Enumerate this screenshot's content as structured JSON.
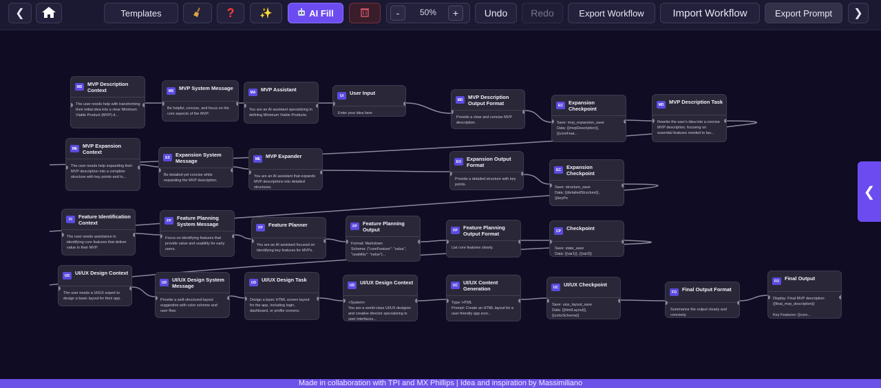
{
  "toolbar": {
    "back_icon": "chevron-left-icon",
    "home_icon": "home-icon",
    "templates_label": "Templates",
    "broom_icon": "broom-icon",
    "help_icon": "question-mark-icon",
    "sparkle_icon": "sparkles-icon",
    "ai_fill_label": "AI Fill",
    "trash_icon": "trash-icon",
    "zoom_out_label": "-",
    "zoom_value": "50%",
    "zoom_in_label": "+",
    "undo_label": "Undo",
    "redo_label": "Redo",
    "export_workflow_label": "Export Workflow",
    "import_workflow_label": "Import Workflow",
    "export_prompt_label": "Export Prompt",
    "forward_icon": "chevron-right-icon"
  },
  "colors": {
    "accent": "#6c4cf0",
    "canvas": "#0f0c24",
    "node": "#2a2838"
  },
  "nodes": [
    {
      "badge": "MD",
      "title": "MVP Description Context",
      "body": "The user needs help with transforming their initial idea into a clear Minimum Viable Product (MVP) d..."
    },
    {
      "badge": "MS",
      "title": "MVP System Message",
      "body": "Be helpful, concise, and focus on the core aspects of the MVP."
    },
    {
      "badge": "MA",
      "title": "MVP Assistant",
      "body": "You are an AI assistant specializing in defining Minimum Viable Products."
    },
    {
      "badge": "UI",
      "title": "User Input",
      "body": "Enter your idea here"
    },
    {
      "badge": "MD",
      "title": "MVP Description Output Format",
      "body": "Provide a clear and concise MVP description."
    },
    {
      "badge": "EC",
      "title": "Expansion Checkpoint",
      "body": "Save: mvp_expansion_save\nData: {{mvpDescription}},\n{{coreFeat..."
    },
    {
      "badge": "MD",
      "title": "MVP Description Task",
      "body": "Rewrite the user's idea into a concise MVP description, focusing on essential features needed to lau..."
    },
    {
      "badge": "ME",
      "title": "MVP Expansion Context",
      "body": "The user needs help expanding their MVP description into a complete structure with key points and lo..."
    },
    {
      "badge": "ES",
      "title": "Expansion System Message",
      "body": "Be detailed yet concise while expanding the MVP description."
    },
    {
      "badge": "ME",
      "title": "MVP Expander",
      "body": "You are an AI assistant that expands MVP descriptions into detailed structures."
    },
    {
      "badge": "EO",
      "title": "Expansion Output Format",
      "body": "Provide a detailed structure with key points."
    },
    {
      "badge": "EC",
      "title": "Expansion Checkpoint",
      "body": "Save: structure_save\nData: {{detailedStructure}},\n{{keyPo"
    },
    {
      "badge": "FI",
      "title": "Feature Identification Context",
      "body": "The user needs assistance in identifying core features that deliver value in their MVP."
    },
    {
      "badge": "FP",
      "title": "Feature Planning System Message",
      "body": "Focus on identifying features that provide value and usability for early users."
    },
    {
      "badge": "FP",
      "title": "Feature Planner",
      "body": "You are an AI assistant focused on identifying key features for MVPs."
    },
    {
      "badge": "FP",
      "title": "Feature Planning Output",
      "body": "Format: Markdown\nSchema: {\"coreFeature\": \"value\",\n\"usability\": \"value\"}..."
    },
    {
      "badge": "FP",
      "title": "Feature Planning Output Format",
      "body": "List core features clearly."
    },
    {
      "badge": "CP",
      "title": "Checkpoint",
      "body": "Save: state_save\nData: {{var1}}, {{var2}}"
    },
    {
      "badge": "UD",
      "title": "UI/UX Design Context",
      "body": "The user needs a UI/UX expert to design a basic layout for their app."
    },
    {
      "badge": "UD",
      "title": "UI/UX Design System Message",
      "body": "Provide a well-structured layout suggestion with color scheme and user flow."
    },
    {
      "badge": "UD",
      "title": "UI/UX Design Task",
      "body": "Design a basic HTML screen layout for the app, including login, dashboard, or profile screens."
    },
    {
      "badge": "UD",
      "title": "UI/UX Design Context",
      "body": "<System>\nYou are a world-class UI/UX designer and creative director specializing in user interfaces..."
    },
    {
      "badge": "UC",
      "title": "UI/UX Content Generation",
      "body": "Type: HTML\nPrompt: Create an HTML layout for a user-friendly app scre..."
    },
    {
      "badge": "UC",
      "title": "UI/UX Checkpoint",
      "body": "Save: uiux_layout_save\nData: {{htmlLayout}},\n{{colorScheme}}"
    },
    {
      "badge": "FO",
      "title": "Final Output Format",
      "body": "Summarize the output clearly and concisely."
    },
    {
      "badge": "FO",
      "title": "Final Output",
      "body": "Display: Final MVP description: {{final_mvp_description}}\n\nKey Features: {{core..."
    }
  ],
  "sidebar_toggle_icon": "chevron-left-icon",
  "footer_text": "Made in collaboration with TPI and MX Phillips | Idea and inspiration by Massimiliano"
}
